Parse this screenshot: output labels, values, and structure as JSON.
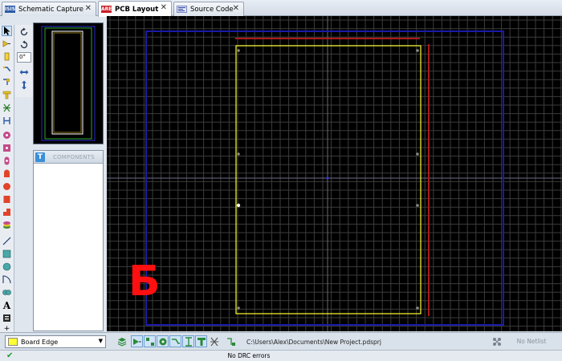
{
  "tabs": [
    {
      "label": "Schematic Capture",
      "icon_text": "ISIS",
      "icon_color": "#2d5aa8",
      "active": false
    },
    {
      "label": "PCB Layout",
      "icon_text": "ARES",
      "icon_color": "#c8202a",
      "active": true
    },
    {
      "label": "Source Code",
      "icon_text": "",
      "icon_color": "#7a86c6",
      "active": false
    }
  ],
  "rotation": {
    "angle": "0°"
  },
  "components": {
    "header": "COMPONENTS",
    "header_icon": "T"
  },
  "layer": {
    "selected": "Board Edge",
    "color": "#ffff33"
  },
  "project_path": "C:\\Users\\Alex\\Documents\\New Project.pdsprj",
  "netlist": {
    "label": "No Netlist"
  },
  "status": {
    "text": "No DRC errors"
  },
  "overlay": {
    "letter": "Б",
    "color": "#ff1010"
  },
  "colors": {
    "grid": "#3c3c3c",
    "board_edge": "#ffff33",
    "axis": "#7a7a7a",
    "blue_boundary": "#1a1aa8",
    "red_boundary": "#a81a1a"
  }
}
